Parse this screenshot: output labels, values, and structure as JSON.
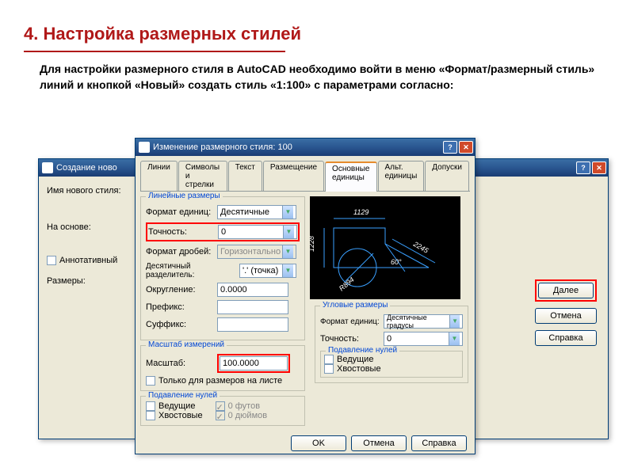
{
  "page": {
    "title": "4. Настройка размерных стилей",
    "desc": "Для настройки размерного стиля в AutoCAD необходимо войти в меню «Формат/размерный стиль» линий и кнопкой «Новый» создать стиль «1:100» с параметрами согласно:"
  },
  "dlg1": {
    "title": "Создание ново",
    "lbl_new_style": "Имя нового стиля:",
    "lbl_based_on": "На основе:",
    "chk_annotative": "Аннотативный",
    "lbl_sizes": "Размеры:",
    "btn_next": "Далее",
    "btn_cancel": "Отмена",
    "btn_help": "Справка"
  },
  "dlg2": {
    "title": "Изменение размерного стиля: 100",
    "tabs": {
      "lines": "Линии",
      "symbols": "Символы и стрелки",
      "text": "Текст",
      "placement": "Размещение",
      "primary": "Основные единицы",
      "alt": "Альт. единицы",
      "tol": "Допуски"
    },
    "linear": {
      "legend": "Линейные размеры",
      "format_lbl": "Формат единиц:",
      "format_val": "Десятичные",
      "precision_lbl": "Точность:",
      "precision_val": "0",
      "frac_lbl": "Формат дробей:",
      "frac_val": "Горизонтально",
      "sep_lbl": "Десятичный разделитель:",
      "sep_val": "'.' (точка)",
      "round_lbl": "Округление:",
      "round_val": "0.0000",
      "prefix_lbl": "Префикс:",
      "prefix_val": "",
      "suffix_lbl": "Суффикс:",
      "suffix_val": ""
    },
    "scale": {
      "legend": "Масштаб измерений",
      "scale_lbl": "Масштаб:",
      "scale_val": "100.0000",
      "chk_layout": "Только для размеров на листе"
    },
    "suppress_zeros": {
      "legend": "Подавление нулей",
      "leading": "Ведущие",
      "trailing": "Хвостовые",
      "feet": "0 футов",
      "inches": "0 дюймов"
    },
    "angular": {
      "legend": "Угловые размеры",
      "format_lbl": "Формат единиц:",
      "format_val": "Десятичные градусы",
      "precision_lbl": "Точность:",
      "precision_val": "0",
      "sup_legend": "Подавление нулей",
      "leading": "Ведущие",
      "trailing": "Хвостовые"
    },
    "preview": {
      "top": "1129",
      "left": "1228",
      "right": "2245",
      "angle": "60°",
      "radius": "R894"
    },
    "btn_ok": "OK",
    "btn_cancel": "Отмена",
    "btn_help": "Справка"
  }
}
